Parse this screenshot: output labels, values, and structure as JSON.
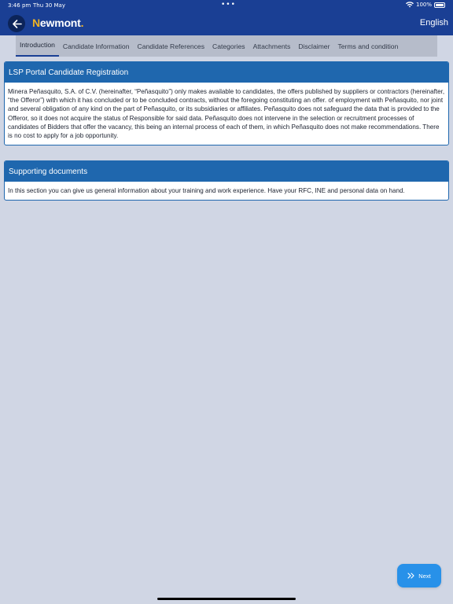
{
  "status_bar": {
    "time": "3:46 pm",
    "date": "Thu 30 May",
    "battery": "100%"
  },
  "header": {
    "logo_text": "ewmont",
    "logo_initial": "N",
    "logo_suffix": ".",
    "language": "English"
  },
  "tabs": [
    {
      "label": "Introduction",
      "active": true
    },
    {
      "label": "Candidate Information"
    },
    {
      "label": "Candidate References"
    },
    {
      "label": "Categories"
    },
    {
      "label": "Attachments"
    },
    {
      "label": "Disclaimer"
    },
    {
      "label": "Terms and condition"
    }
  ],
  "sections": {
    "registration": {
      "title": "LSP Portal Candidate Registration",
      "body": "Minera Peñasquito, S.A. of C.V. (hereinafter, “Peñasquito”) only makes available to candidates, the offers published by suppliers or contractors (hereinafter, “the Offeror”) with which it has concluded or to be concluded contracts, without the foregoing constituting an offer. of employment with Peñasquito, nor joint and several obligation of any kind on the part of Peñasquito, or its subsidiaries or affiliates. Peñasquito does not safeguard the data that is provided to the Offeror, so it does not acquire the status of Responsible for said data. Peñasquito does not intervene in the selection or recruitment processes of candidates of Bidders that offer the vacancy, this being an internal process of each of them, in which Peñasquito does not make recommendations. There is no cost to apply for a job opportunity."
    },
    "supporting": {
      "title": "Supporting documents",
      "body": "In this section you can give us general information about your training and work experience. Have your RFC, INE and personal data on hand."
    }
  },
  "footer": {
    "next_label": "Next"
  },
  "colors": {
    "header": "#1a3f94",
    "accent": "#1f67ae",
    "next_button": "#2891e9",
    "background": "#d0d6e4"
  }
}
